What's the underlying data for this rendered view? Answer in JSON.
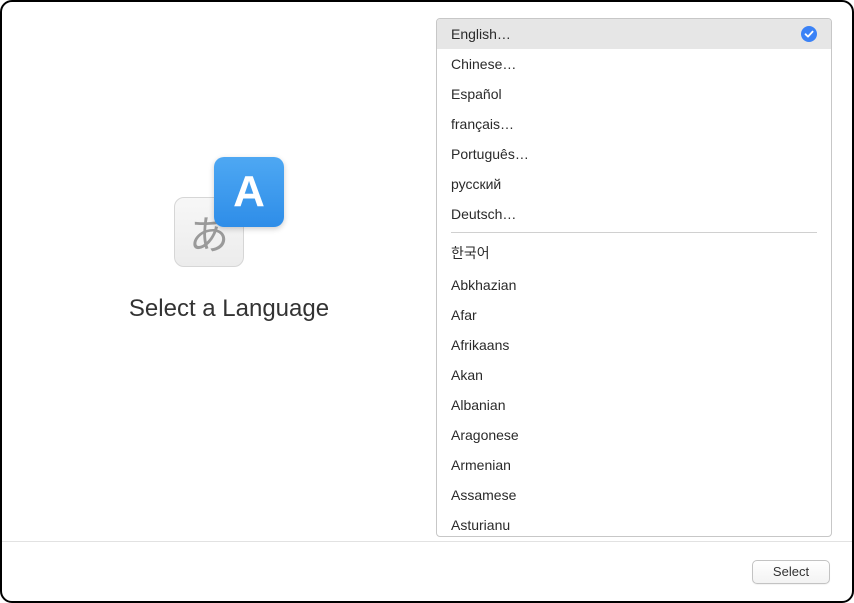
{
  "heading": "Select a Language",
  "icon_back_char": "あ",
  "icon_front_char": "A",
  "selected_index": 0,
  "languages_primary": [
    "English…",
    "Chinese…",
    "Español",
    "français…",
    "Português…",
    "русский",
    "Deutsch…"
  ],
  "languages_secondary": [
    "한국어",
    "Abkhazian",
    "Afar",
    "Afrikaans",
    "Akan",
    "Albanian",
    "Aragonese",
    "Armenian",
    "Assamese",
    "Asturianu"
  ],
  "footer": {
    "select_label": "Select"
  }
}
